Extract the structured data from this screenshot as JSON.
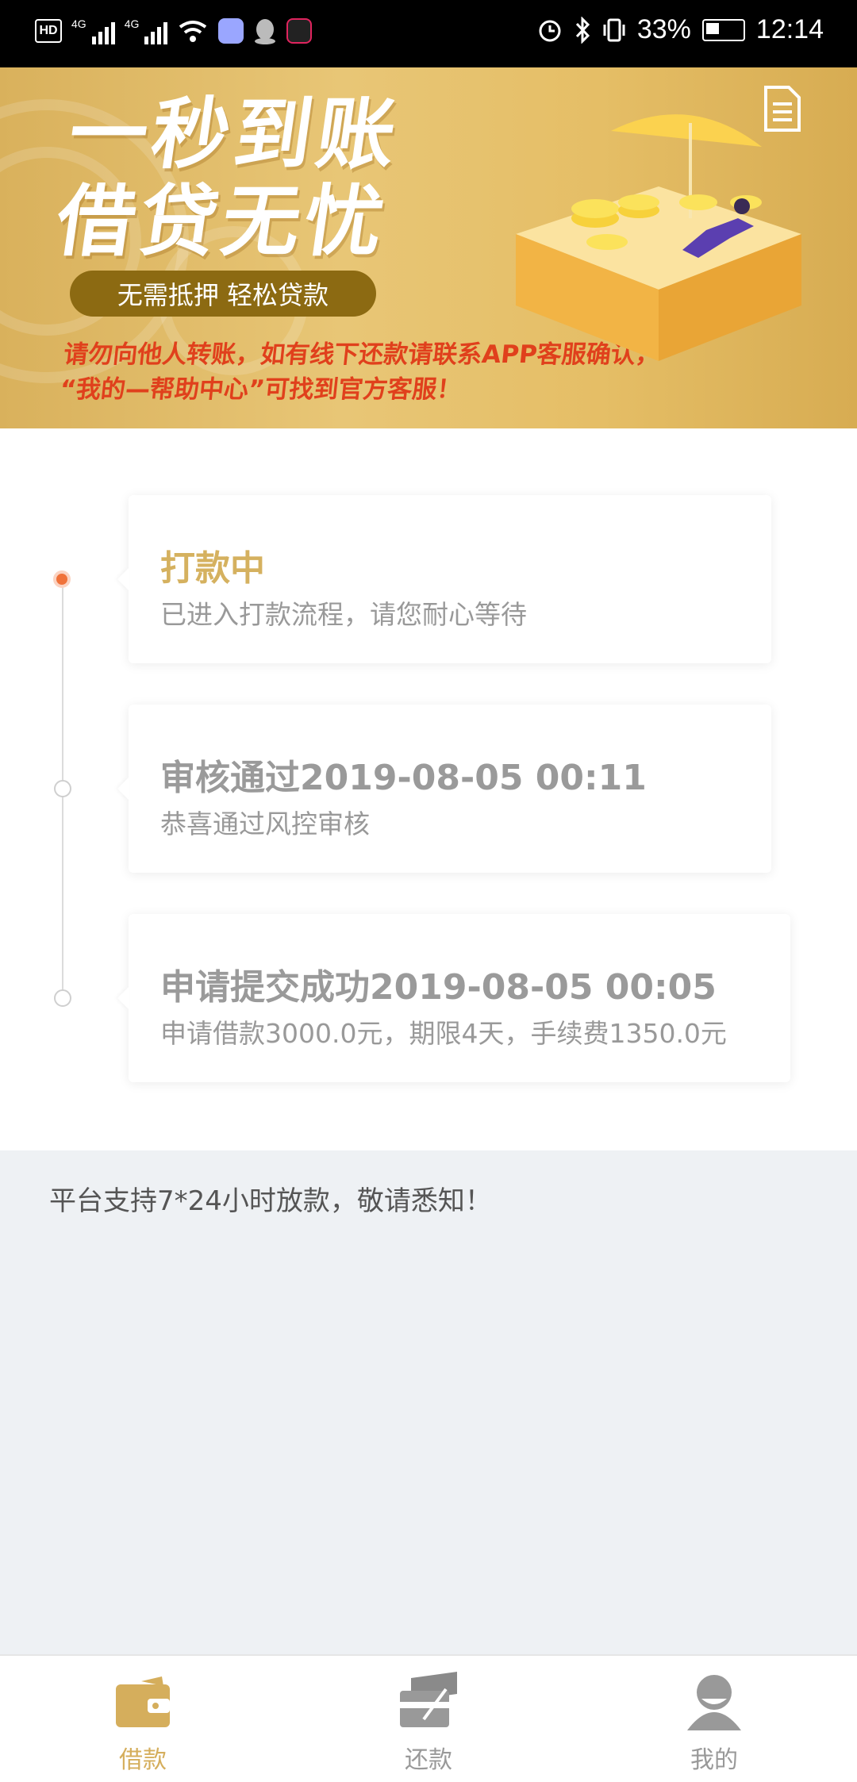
{
  "status_bar": {
    "left_badges": [
      "HD",
      "4G",
      "4G"
    ],
    "battery": "33%",
    "time": "12:14"
  },
  "banner": {
    "headline_line1": "一秒到账",
    "headline_line2": "借贷无忧",
    "pill": "无需抵押  轻松贷款",
    "warning_line1": "请勿向他人转账，如有线下还款请联系APP客服确认，",
    "warning_line2": "“我的—帮助中心”可找到官方客服！",
    "colors": {
      "bg": "#e3bb67",
      "pill": "#8c6a12",
      "warning": "#e0401c"
    }
  },
  "timeline": [
    {
      "title": "打款中",
      "desc": "已进入打款流程，请您耐心等待",
      "state": "active"
    },
    {
      "title": "审核通过2019-08-05 00:11",
      "desc": "恭喜通过风控审核",
      "state": "done"
    },
    {
      "title": "申请提交成功2019-08-05 00:05",
      "desc": "申请借款3000.0元，期限4天，手续费1350.0元",
      "state": "done"
    }
  ],
  "notice": "平台支持7*24小时放款，敬请悉知！",
  "bottom_nav": {
    "items": [
      {
        "label": "借款",
        "icon": "wallet-icon",
        "active": true
      },
      {
        "label": "还款",
        "icon": "card-icon",
        "active": false
      },
      {
        "label": "我的",
        "icon": "user-icon",
        "active": false
      }
    ]
  }
}
